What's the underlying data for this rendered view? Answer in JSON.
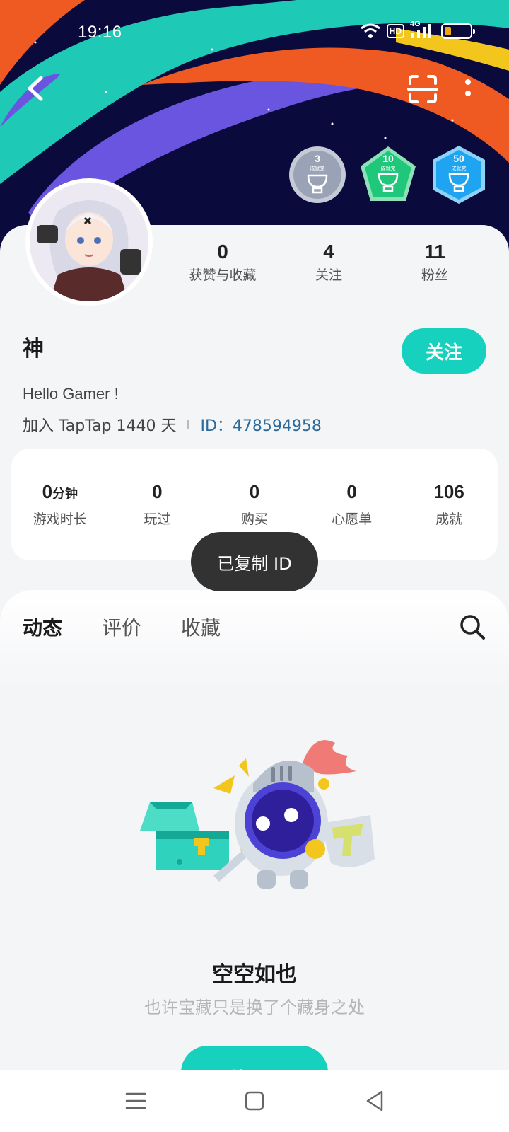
{
  "status_bar": {
    "time": "19:16",
    "hd": "HD",
    "network": "4G",
    "battery_level": 0.25
  },
  "badges": [
    {
      "value": "3",
      "label": "成就党",
      "color": "#9aa3b5"
    },
    {
      "value": "10",
      "label": "成就党",
      "color": "#1fc77a"
    },
    {
      "value": "50",
      "label": "成就党",
      "color": "#1ea4f0"
    }
  ],
  "profile_stats": [
    {
      "value": "0",
      "label": "获赞与收藏"
    },
    {
      "value": "4",
      "label": "关注"
    },
    {
      "value": "11",
      "label": "粉丝"
    }
  ],
  "user": {
    "name": "神",
    "follow_label": "关注",
    "bio": "Hello Gamer !",
    "joined": "加入 TapTap 1440 天",
    "id": "ID：478594958"
  },
  "game_stats": [
    {
      "value": "0",
      "unit": "分钟",
      "label": "游戏时长"
    },
    {
      "value": "0",
      "unit": "",
      "label": "玩过"
    },
    {
      "value": "0",
      "unit": "",
      "label": "购买"
    },
    {
      "value": "0",
      "unit": "",
      "label": "心愿单"
    },
    {
      "value": "106",
      "unit": "",
      "label": "成就"
    }
  ],
  "toast": "已复制 ID",
  "tabs": [
    {
      "label": "动态",
      "active": true
    },
    {
      "label": "评价",
      "active": false
    },
    {
      "label": "收藏",
      "active": false
    }
  ],
  "empty_state": {
    "title": "空空如也",
    "subtitle": "也许宝藏只是换了个藏身之处",
    "refresh_label": "刷新一下"
  },
  "colors": {
    "accent": "#15d1bd",
    "id_link": "#2b6a9b",
    "toast_bg": "#323232"
  },
  "icons": {
    "back": "back-arrow-icon",
    "scan": "scan-icon",
    "more": "more-vertical-icon",
    "search": "search-icon",
    "nav_menu": "menu-icon",
    "nav_home": "home-square-icon",
    "nav_back": "back-triangle-icon"
  }
}
